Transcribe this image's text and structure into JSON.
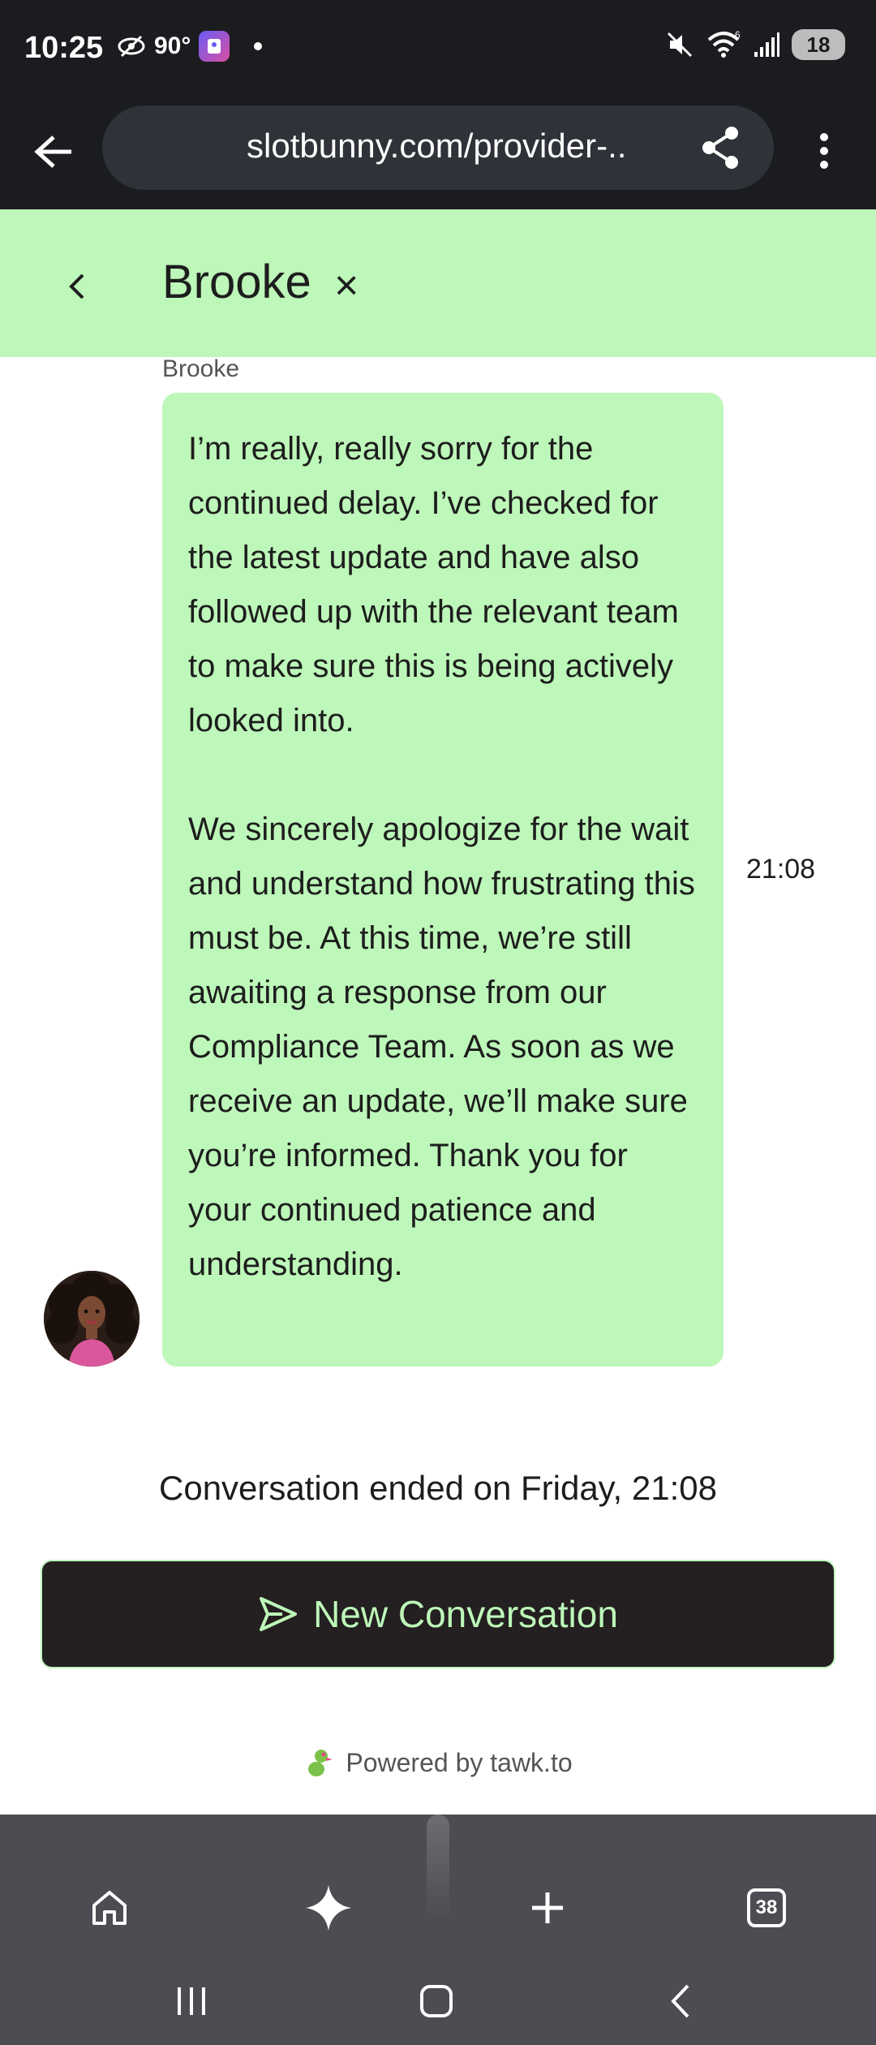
{
  "status_bar": {
    "time": "10:25",
    "temperature": "90°",
    "signal_label": "6",
    "battery": "18"
  },
  "browser": {
    "url": "slotbunny.com/provider-..",
    "tab_count": "38"
  },
  "chat_header": {
    "title": "Brooke",
    "close_label": "×"
  },
  "message": {
    "sender": "Brooke",
    "paragraph_1": "I’m really, really sorry for the continued delay. I’ve checked for the latest update and have also followed up with the relevant team to make sure this is being actively looked into.",
    "paragraph_2": "We sincerely apologize for the wait and understand how frustrating this must be. At this time, we’re still awaiting a response from our Compliance Team. As soon as we receive an update, we’ll make sure you’re informed. Thank you for your continued patience and understanding.",
    "time": "21:08"
  },
  "conversation_ended": "Conversation ended on Friday, 21:08",
  "new_conversation_label": "New Conversation",
  "powered_by": "Powered by tawk.to",
  "colors": {
    "accent_green": "#bdf7b9",
    "dark_button": "#241f20",
    "top_bar": "#1b1c1f",
    "nav_bar": "#4c4c52"
  }
}
